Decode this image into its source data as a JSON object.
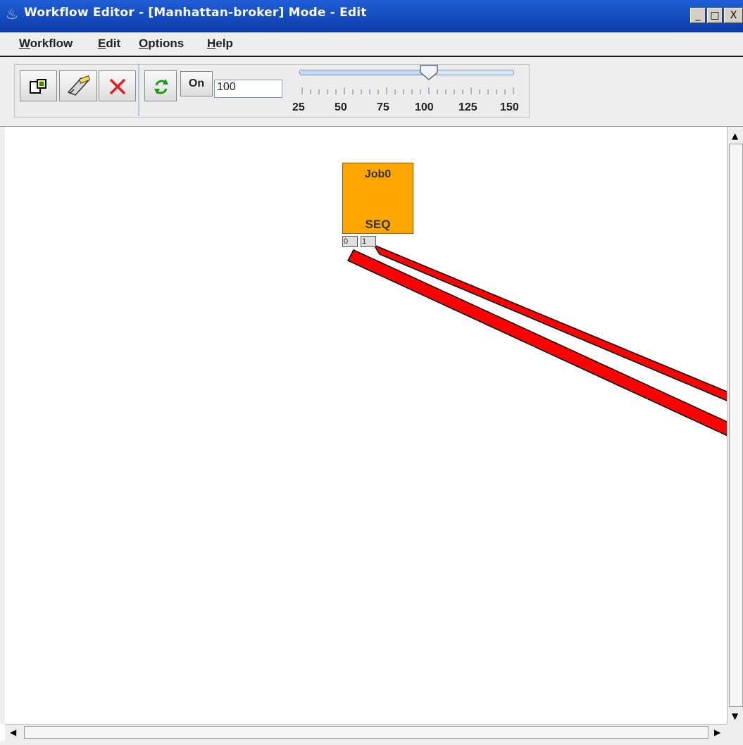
{
  "window": {
    "title": "Workflow Editor - [Manhattan-broker] Mode - Edit",
    "controls": {
      "minimize": "_",
      "maximize": "□",
      "close": "X"
    }
  },
  "menu": {
    "items": [
      {
        "first": "W",
        "rest": "orkflow"
      },
      {
        "first": "E",
        "rest": "dit"
      },
      {
        "first": "O",
        "rest": "ptions"
      },
      {
        "first": "H",
        "rest": "elp"
      }
    ]
  },
  "toolbar": {
    "buttons": [
      "new-job-icon",
      "edit-connection-icon",
      "delete-icon",
      "refresh-icon"
    ],
    "on_label": "On",
    "zoom_value": "100",
    "slider": {
      "min": 25,
      "max": 150,
      "value": 100,
      "labels": [
        "25",
        "50",
        "75",
        "100",
        "125",
        "150"
      ]
    }
  },
  "workflow": {
    "job": {
      "name": "Job0",
      "type": "SEQ"
    },
    "ports": [
      "0",
      "1"
    ]
  },
  "colors": {
    "titlebar": "#0c3aa8",
    "job_fill": "#ffa500",
    "edge": "#ff0000"
  }
}
